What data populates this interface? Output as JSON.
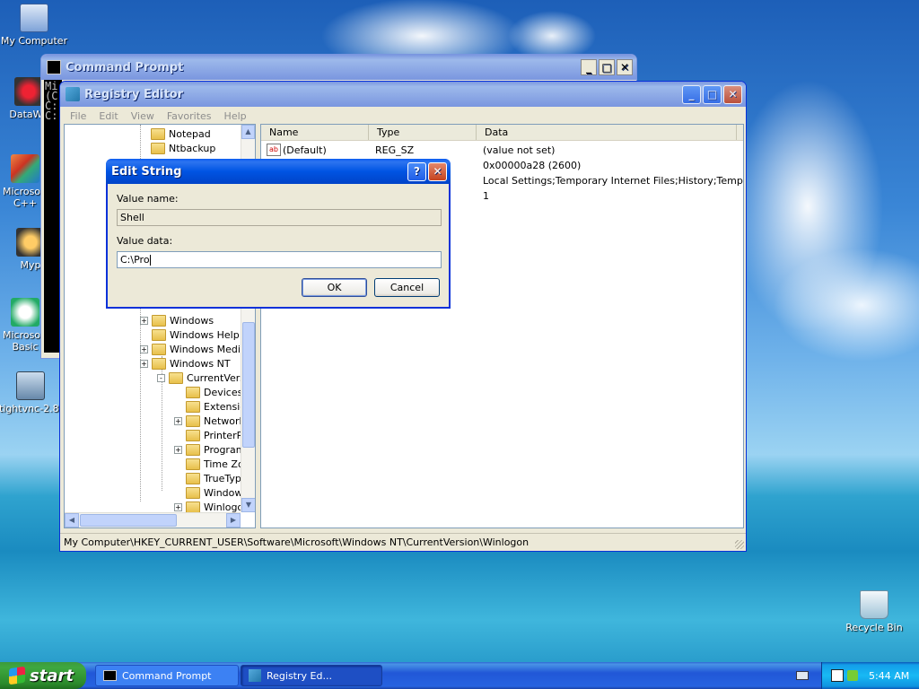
{
  "desktop": {
    "icons": [
      {
        "label": "My Computer"
      },
      {
        "label": "DataWa"
      },
      {
        "label": "Microsoft C++"
      },
      {
        "label": "Myp"
      },
      {
        "label": "Microsoft Basic"
      },
      {
        "label": "tightvnc-2.8."
      },
      {
        "label": "Recycle Bin"
      }
    ]
  },
  "cmd_window": {
    "title": "Command Prompt",
    "lines": [
      "Mi",
      "(C",
      "",
      "C:",
      "",
      "C:"
    ]
  },
  "regedit": {
    "title": "Registry Editor",
    "menu": [
      "File",
      "Edit",
      "View",
      "Favorites",
      "Help"
    ],
    "tree": [
      {
        "label": "Notepad",
        "expander": ""
      },
      {
        "label": "Ntbackup",
        "expander": ""
      },
      {
        "label": "Windows",
        "expander": "+"
      },
      {
        "label": "Windows Help",
        "expander": ""
      },
      {
        "label": "Windows Media",
        "expander": "+"
      },
      {
        "label": "Windows NT",
        "expander": "+"
      },
      {
        "label": "CurrentVers",
        "expander": "-"
      },
      {
        "label": "Devices",
        "expander": ""
      },
      {
        "label": "Extensic",
        "expander": ""
      },
      {
        "label": "Network",
        "expander": "+"
      },
      {
        "label": "PrinterP",
        "expander": ""
      },
      {
        "label": "Program",
        "expander": "+"
      },
      {
        "label": "Time Zoi",
        "expander": ""
      },
      {
        "label": "TrueTyp",
        "expander": ""
      },
      {
        "label": "Window",
        "expander": ""
      },
      {
        "label": "Winlogo",
        "expander": "+"
      }
    ],
    "list_headers": [
      "Name",
      "Type",
      "Data"
    ],
    "list_rows": [
      {
        "name": "(Default)",
        "type": "REG_SZ",
        "data": "(value not set)"
      },
      {
        "name": "",
        "type": "",
        "data": "0x00000a28 (2600)"
      },
      {
        "name": "",
        "type": "",
        "data": "Local Settings;Temporary Internet Files;History;Temp"
      },
      {
        "name": "",
        "type": "",
        "data": "1"
      }
    ],
    "status": "My Computer\\HKEY_CURRENT_USER\\Software\\Microsoft\\Windows NT\\CurrentVersion\\Winlogon"
  },
  "dialog": {
    "title": "Edit String",
    "value_name_label": "Value name:",
    "value_name": "Shell",
    "value_data_label": "Value data:",
    "value_data": "C:\\Pro",
    "ok_label": "OK",
    "cancel_label": "Cancel",
    "help_glyph": "?",
    "close_glyph": "✕"
  },
  "taskbar": {
    "start_label": "start",
    "tasks": [
      {
        "label": "Command Prompt"
      },
      {
        "label": "Registry Ed..."
      }
    ],
    "clock": "5:44 AM"
  },
  "colors": {
    "title_active": "#0054e3",
    "title_inactive": "#7a96df",
    "start_green": "#3c9a3c",
    "taskbar_blue": "#2157d7"
  }
}
